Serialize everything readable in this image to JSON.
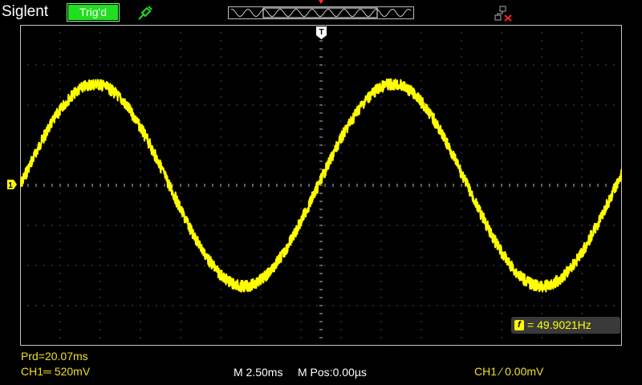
{
  "brand": "Siglent",
  "status": "Trig'd",
  "colors": {
    "trace": "#ffff00",
    "status_bg": "#22dd22",
    "grid": "#c8c8c8",
    "label": "#f0e020"
  },
  "icons": {
    "probe": "probe-icon",
    "network": "network-disconnected-icon"
  },
  "measurement": {
    "period": "Prd=20.07ms",
    "frequency": "= 49.9021Hz",
    "frequency_icon": "f"
  },
  "markers": {
    "trigger_position": "T",
    "channel": "1"
  },
  "bottom": {
    "ch1_scale": "CH1═ 520mV",
    "timebase": "M 2.50ms",
    "mpos": "M Pos:0.00µs",
    "trigger": "CH1 ∕ 0.00mV"
  },
  "waveform": {
    "shape": "sine",
    "cycles_visible": 2.02,
    "phase_start": "rising zero-crossing"
  }
}
